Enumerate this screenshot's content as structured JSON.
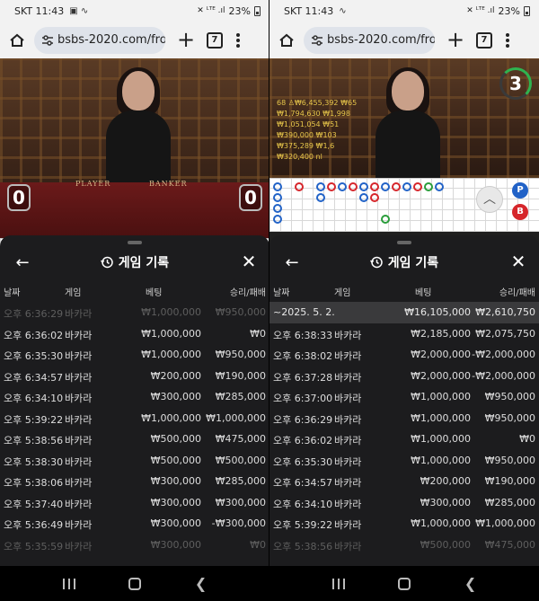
{
  "status": {
    "time": "SKT 11:43",
    "battery": "23%"
  },
  "browser": {
    "url": "bsbs-2020.com/fron",
    "tab_count": "7"
  },
  "video_left": {
    "player_label": "PLAYER",
    "banker_label": "BANKER",
    "player_score": "0",
    "banker_score": "0"
  },
  "video_right": {
    "countdown": "3",
    "stats": [
      "68 ♙₩6,455,392 ₩65",
      "₩1,794,630 ₩1,998",
      "₩1,051,054 ₩51",
      "₩390,000 ₩103",
      "₩375,289 ₩1,6",
      "₩320,400 nl"
    ]
  },
  "roadmap_right": {
    "p_label": "P",
    "b_label": "B"
  },
  "sheet": {
    "title": "게임 기록",
    "columns": {
      "date": "날짜",
      "game": "게임",
      "bet": "베팅",
      "result": "승리/패배"
    }
  },
  "left_rows": [
    {
      "date": "오후 6:36:29",
      "game": "바카라",
      "bet": "₩1,000,000",
      "result": "₩950,000",
      "faded": true
    },
    {
      "date": "오후 6:36:02",
      "game": "바카라",
      "bet": "₩1,000,000",
      "result": "₩0"
    },
    {
      "date": "오후 6:35:30",
      "game": "바카라",
      "bet": "₩1,000,000",
      "result": "₩950,000"
    },
    {
      "date": "오후 6:34:57",
      "game": "바카라",
      "bet": "₩200,000",
      "result": "₩190,000"
    },
    {
      "date": "오후 6:34:10",
      "game": "바카라",
      "bet": "₩300,000",
      "result": "₩285,000"
    },
    {
      "date": "오후 5:39:22",
      "game": "바카라",
      "bet": "₩1,000,000",
      "result": "₩1,000,000"
    },
    {
      "date": "오후 5:38:56",
      "game": "바카라",
      "bet": "₩500,000",
      "result": "₩475,000"
    },
    {
      "date": "오후 5:38:30",
      "game": "바카라",
      "bet": "₩500,000",
      "result": "₩500,000"
    },
    {
      "date": "오후 5:38:06",
      "game": "바카라",
      "bet": "₩300,000",
      "result": "₩285,000"
    },
    {
      "date": "오후 5:37:40",
      "game": "바카라",
      "bet": "₩300,000",
      "result": "₩300,000"
    },
    {
      "date": "오후 5:36:49",
      "game": "바카라",
      "bet": "₩300,000",
      "result": "-₩300,000"
    },
    {
      "date": "오후 5:35:59",
      "game": "바카라",
      "bet": "₩300,000",
      "result": "₩0",
      "faded": true
    }
  ],
  "right_date_row": {
    "date": "~2025. 5. 2.",
    "bet": "₩16,105,000",
    "result": "₩2,610,750"
  },
  "right_rows": [
    {
      "date": "오후 6:38:33",
      "game": "바카라",
      "bet": "₩2,185,000",
      "result": "₩2,075,750"
    },
    {
      "date": "오후 6:38:02",
      "game": "바카라",
      "bet": "₩2,000,000",
      "result": "-₩2,000,000"
    },
    {
      "date": "오후 6:37:28",
      "game": "바카라",
      "bet": "₩2,000,000",
      "result": "-₩2,000,000"
    },
    {
      "date": "오후 6:37:00",
      "game": "바카라",
      "bet": "₩1,000,000",
      "result": "₩950,000"
    },
    {
      "date": "오후 6:36:29",
      "game": "바카라",
      "bet": "₩1,000,000",
      "result": "₩950,000"
    },
    {
      "date": "오후 6:36:02",
      "game": "바카라",
      "bet": "₩1,000,000",
      "result": "₩0"
    },
    {
      "date": "오후 6:35:30",
      "game": "바카라",
      "bet": "₩1,000,000",
      "result": "₩950,000"
    },
    {
      "date": "오후 6:34:57",
      "game": "바카라",
      "bet": "₩200,000",
      "result": "₩190,000"
    },
    {
      "date": "오후 6:34:10",
      "game": "바카라",
      "bet": "₩300,000",
      "result": "₩285,000"
    },
    {
      "date": "오후 5:39:22",
      "game": "바카라",
      "bet": "₩1,000,000",
      "result": "₩1,000,000"
    },
    {
      "date": "오후 5:38:56",
      "game": "바카라",
      "bet": "₩500,000",
      "result": "₩475,000",
      "faded": true
    }
  ],
  "colors": {
    "sheet_bg": "#1c1c1e",
    "date_row_bg": "#3a3a3c",
    "banker_red": "#d6262b",
    "player_blue": "#2162c7",
    "timer_green": "#2fb350"
  }
}
